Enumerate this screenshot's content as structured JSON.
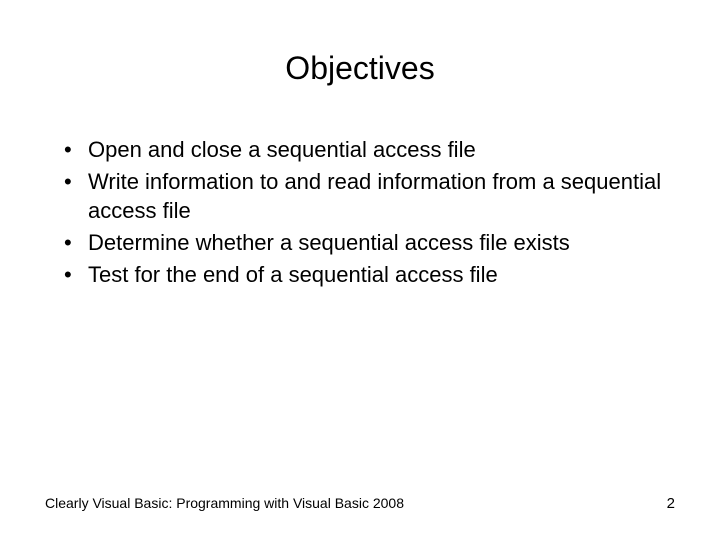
{
  "slide": {
    "title": "Objectives",
    "bullets": [
      "Open and close a sequential access file",
      "Write information to and read information from a sequential access file",
      "Determine whether a sequential access file exists",
      "Test for the end of a sequential access file"
    ],
    "footer": {
      "left": "Clearly Visual Basic: Programming with Visual Basic 2008",
      "right": "2"
    }
  }
}
